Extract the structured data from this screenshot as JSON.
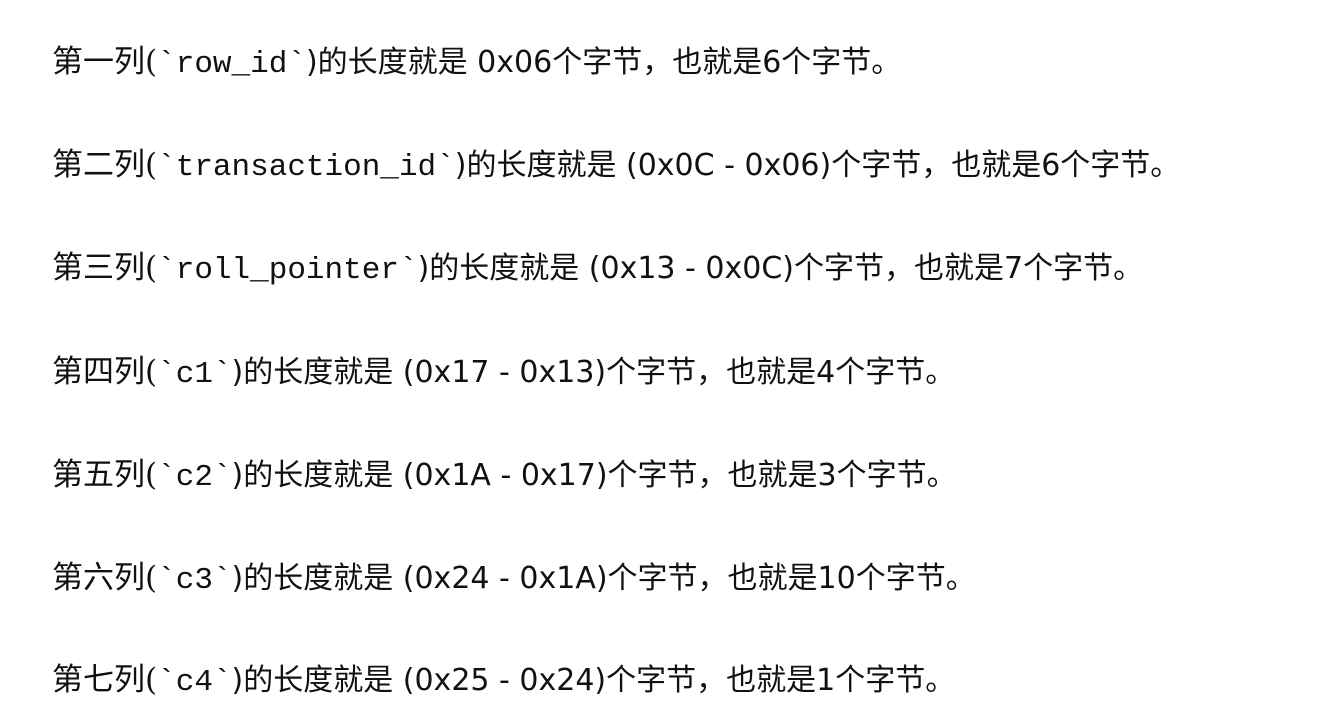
{
  "lines": [
    {
      "prefix": "第一列(",
      "code": "`row_id`",
      "suffix": ")的长度就是 0x06个字节，也就是6个字节。"
    },
    {
      "prefix": "第二列(",
      "code": "`transaction_id`",
      "suffix": ")的长度就是 (0x0C - 0x06)个字节，也就是6个字节。"
    },
    {
      "prefix": "第三列(",
      "code": "`roll_pointer`",
      "suffix": ")的长度就是 (0x13 - 0x0C)个字节，也就是7个字节。"
    },
    {
      "prefix": "第四列(",
      "code": "`c1`",
      "suffix": ")的长度就是 (0x17 - 0x13)个字节，也就是4个字节。"
    },
    {
      "prefix": "第五列(",
      "code": "`c2`",
      "suffix": ")的长度就是 (0x1A - 0x17)个字节，也就是3个字节。"
    },
    {
      "prefix": "第六列(",
      "code": "`c3`",
      "suffix": ")的长度就是 (0x24 - 0x1A)个字节，也就是10个字节。"
    },
    {
      "prefix": "第七列(",
      "code": "`c4`",
      "suffix": ")的长度就是 (0x25 - 0x24)个字节，也就是1个字节。"
    }
  ]
}
